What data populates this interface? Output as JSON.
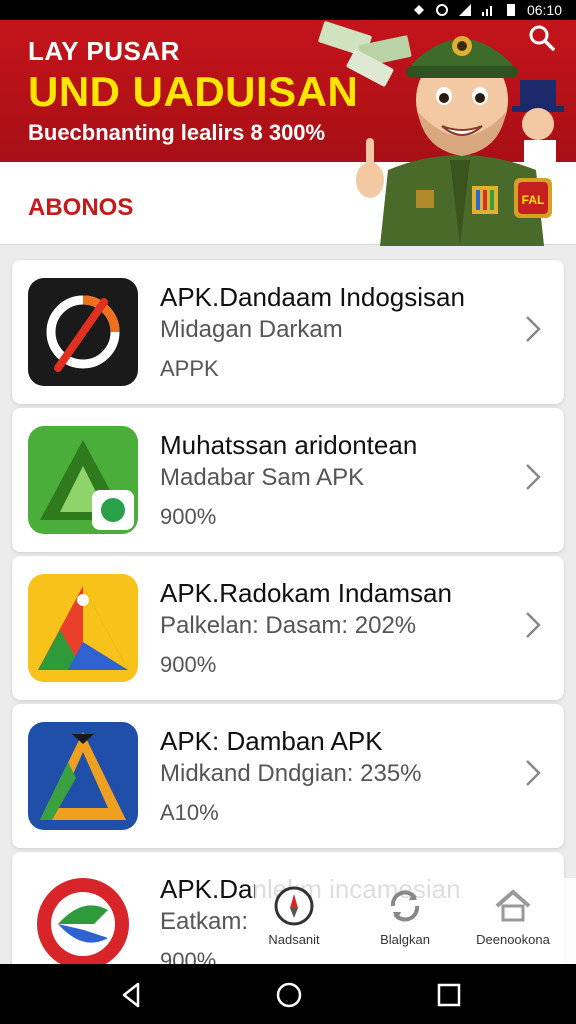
{
  "status_bar": {
    "time": "06:10"
  },
  "banner": {
    "title_line1": "LAY PUSAR",
    "title_line2": "UND UADUISAN",
    "subtitle": "Buecbnanting lealirs 8 300%",
    "badge_text": "FAL"
  },
  "subheader": {
    "label": "ABONOS"
  },
  "apps": [
    {
      "name": "APK.Dandaam Indogsisan",
      "line2": "Midagan Darkam",
      "line3": "APPK",
      "icon": "dark-ring-app-icon"
    },
    {
      "name": "Muhatssan aridontean",
      "line2": "Madabar Sam APK",
      "line3": "900%",
      "icon": "green-triangle-app-icon"
    },
    {
      "name": "APK.Radokam Indamsan",
      "line2": "Palkelan: Dasam: 202%",
      "line3": "900%",
      "icon": "multicolor-triangle-app-icon"
    },
    {
      "name": "APK: Damban APK",
      "line2": "Midkand Dndgian: 235%",
      "line3": "A10%",
      "icon": "blue-a-app-icon"
    },
    {
      "name": "APK.Danlekm incamesian",
      "line2": "Eatkam:",
      "line3": "900%",
      "icon": "red-circle-app-icon"
    }
  ],
  "bottom_tabs": [
    {
      "label": "Nadsanit",
      "icon": "compass-icon"
    },
    {
      "label": "Blalgkan",
      "icon": "refresh-icon"
    },
    {
      "label": "Deenookona",
      "icon": "home-icon"
    }
  ],
  "colors": {
    "banner_red": "#c4141b",
    "accent_yellow": "#ffe600",
    "label_red": "#c41a1a"
  }
}
